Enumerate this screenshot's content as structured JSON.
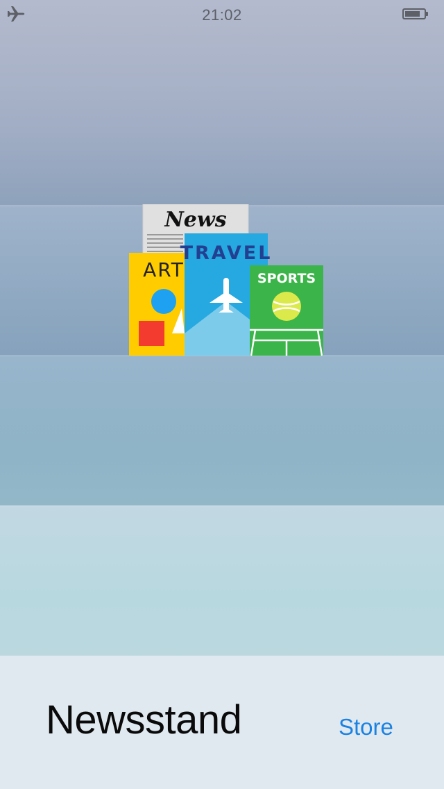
{
  "status_bar": {
    "time": "21:02"
  },
  "magazines": {
    "newspaper_label": "News",
    "art_label": "ART",
    "travel_label": "TRAVEL",
    "sports_label": "SPORTS"
  },
  "bottom": {
    "title": "Newsstand",
    "store_label": "Store"
  },
  "colors": {
    "accent": "#1a82e2",
    "art": "#ffcc00",
    "travel": "#26a9e0",
    "sports": "#3bb54a"
  }
}
